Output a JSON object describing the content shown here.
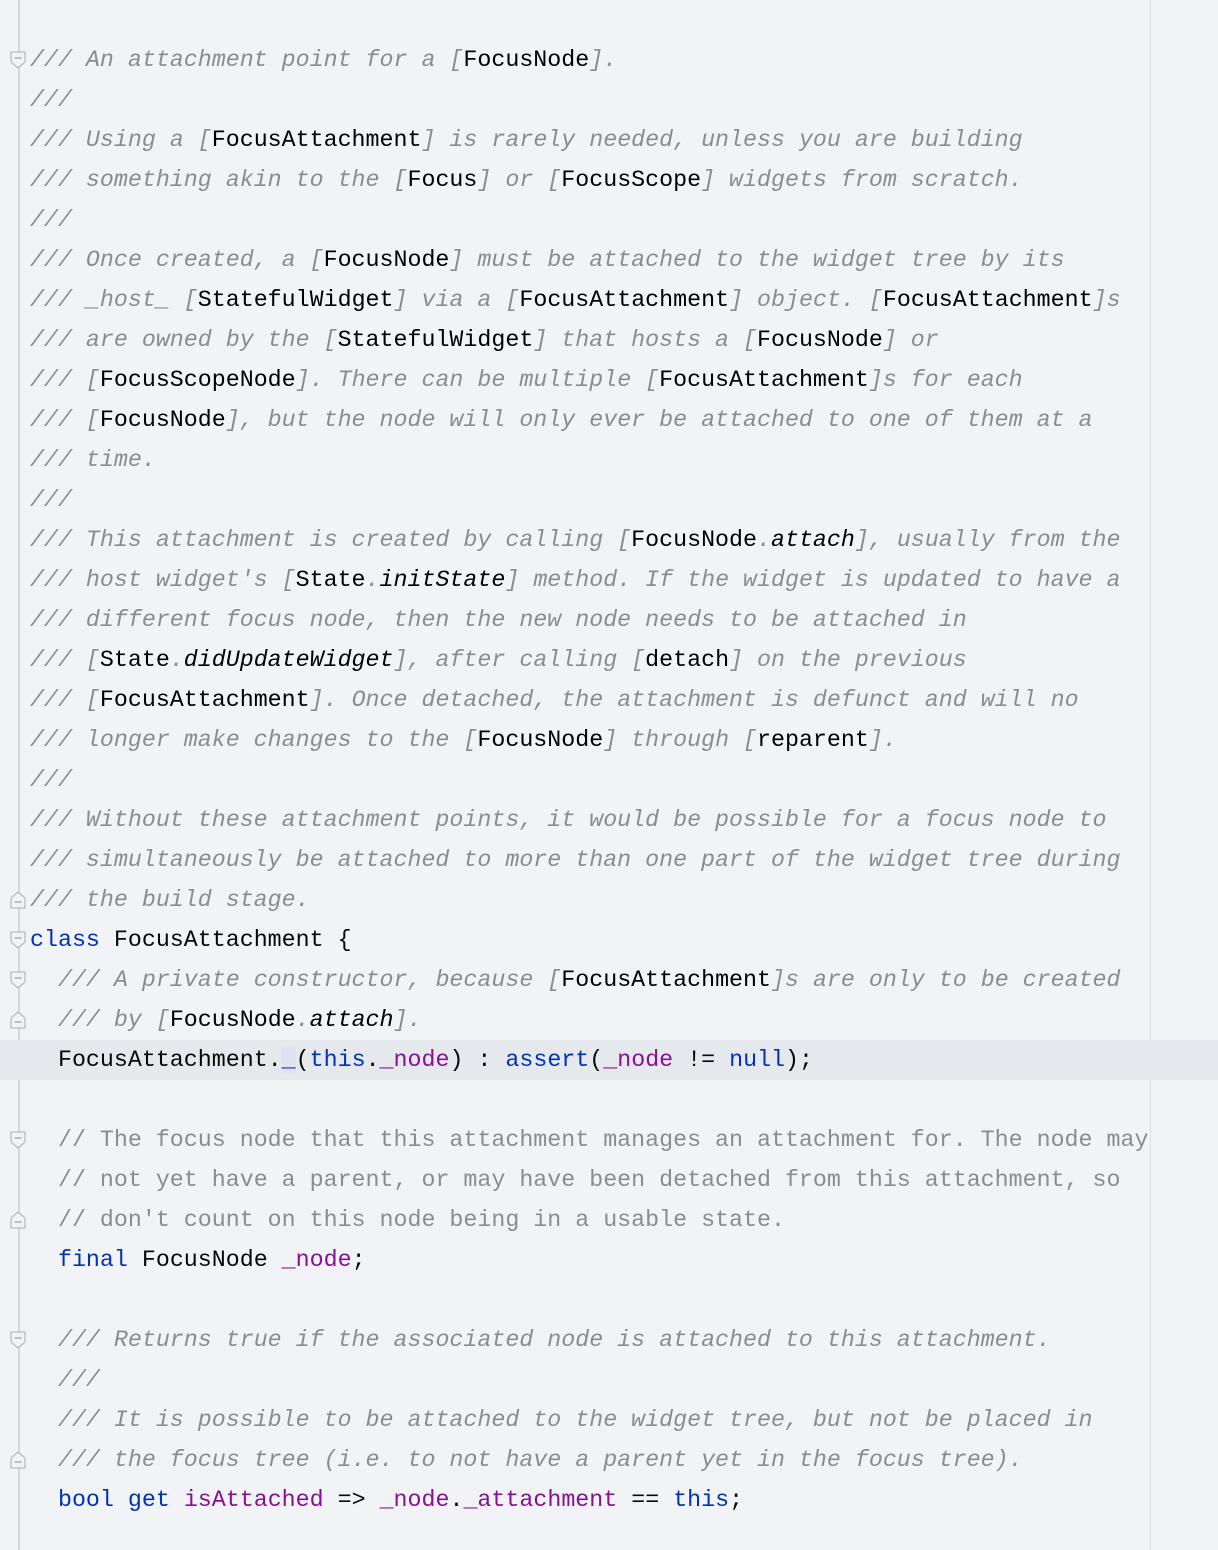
{
  "editor": {
    "language": "dart",
    "current_line": 26,
    "colors": {
      "background": "#f2f3f6",
      "comment": "#8c8c8c",
      "keyword": "#0033b3",
      "field": "#871094",
      "text": "#080808",
      "current_line": "#e5e8ed"
    },
    "fold_markers": [
      {
        "line": 1,
        "kind": "start"
      },
      {
        "line": 22,
        "kind": "end"
      },
      {
        "line": 23,
        "kind": "start"
      },
      {
        "line": 24,
        "kind": "start"
      },
      {
        "line": 25,
        "kind": "end"
      },
      {
        "line": 28,
        "kind": "start"
      },
      {
        "line": 30,
        "kind": "end"
      },
      {
        "line": 33,
        "kind": "start"
      },
      {
        "line": 36,
        "kind": "end"
      }
    ],
    "lines": [
      "/// An attachment point for a [FocusNode].",
      "///",
      "/// Using a [FocusAttachment] is rarely needed, unless you are building",
      "/// something akin to the [Focus] or [FocusScope] widgets from scratch.",
      "///",
      "/// Once created, a [FocusNode] must be attached to the widget tree by its",
      "/// _host_ [StatefulWidget] via a [FocusAttachment] object. [FocusAttachment]s",
      "/// are owned by the [StatefulWidget] that hosts a [FocusNode] or",
      "/// [FocusScopeNode]. There can be multiple [FocusAttachment]s for each",
      "/// [FocusNode], but the node will only ever be attached to one of them at a",
      "/// time.",
      "///",
      "/// This attachment is created by calling [FocusNode.attach], usually from the",
      "/// host widget's [State.initState] method. If the widget is updated to have a",
      "/// different focus node, then the new node needs to be attached in",
      "/// [State.didUpdateWidget], after calling [detach] on the previous",
      "/// [FocusAttachment]. Once detached, the attachment is defunct and will no",
      "/// longer make changes to the [FocusNode] through [reparent].",
      "///",
      "/// Without these attachment points, it would be possible for a focus node to",
      "/// simultaneously be attached to more than one part of the widget tree during",
      "/// the build stage.",
      "class FocusAttachment {",
      "  /// A private constructor, because [FocusAttachment]s are only to be created",
      "  /// by [FocusNode.attach].",
      "  FocusAttachment._(this._node) : assert(_node != null);",
      "",
      "  // The focus node that this attachment manages an attachment for. The node may",
      "  // not yet have a parent, or may have been detached from this attachment, so",
      "  // don't count on this node being in a usable state.",
      "  final FocusNode _node;",
      "",
      "  /// Returns true if the associated node is attached to this attachment.",
      "  ///",
      "  /// It is possible to be attached to the widget tree, but not be placed in",
      "  /// the focus tree (i.e. to not have a parent yet in the focus tree).",
      "  bool get isAttached => _node._attachment == this;"
    ]
  }
}
